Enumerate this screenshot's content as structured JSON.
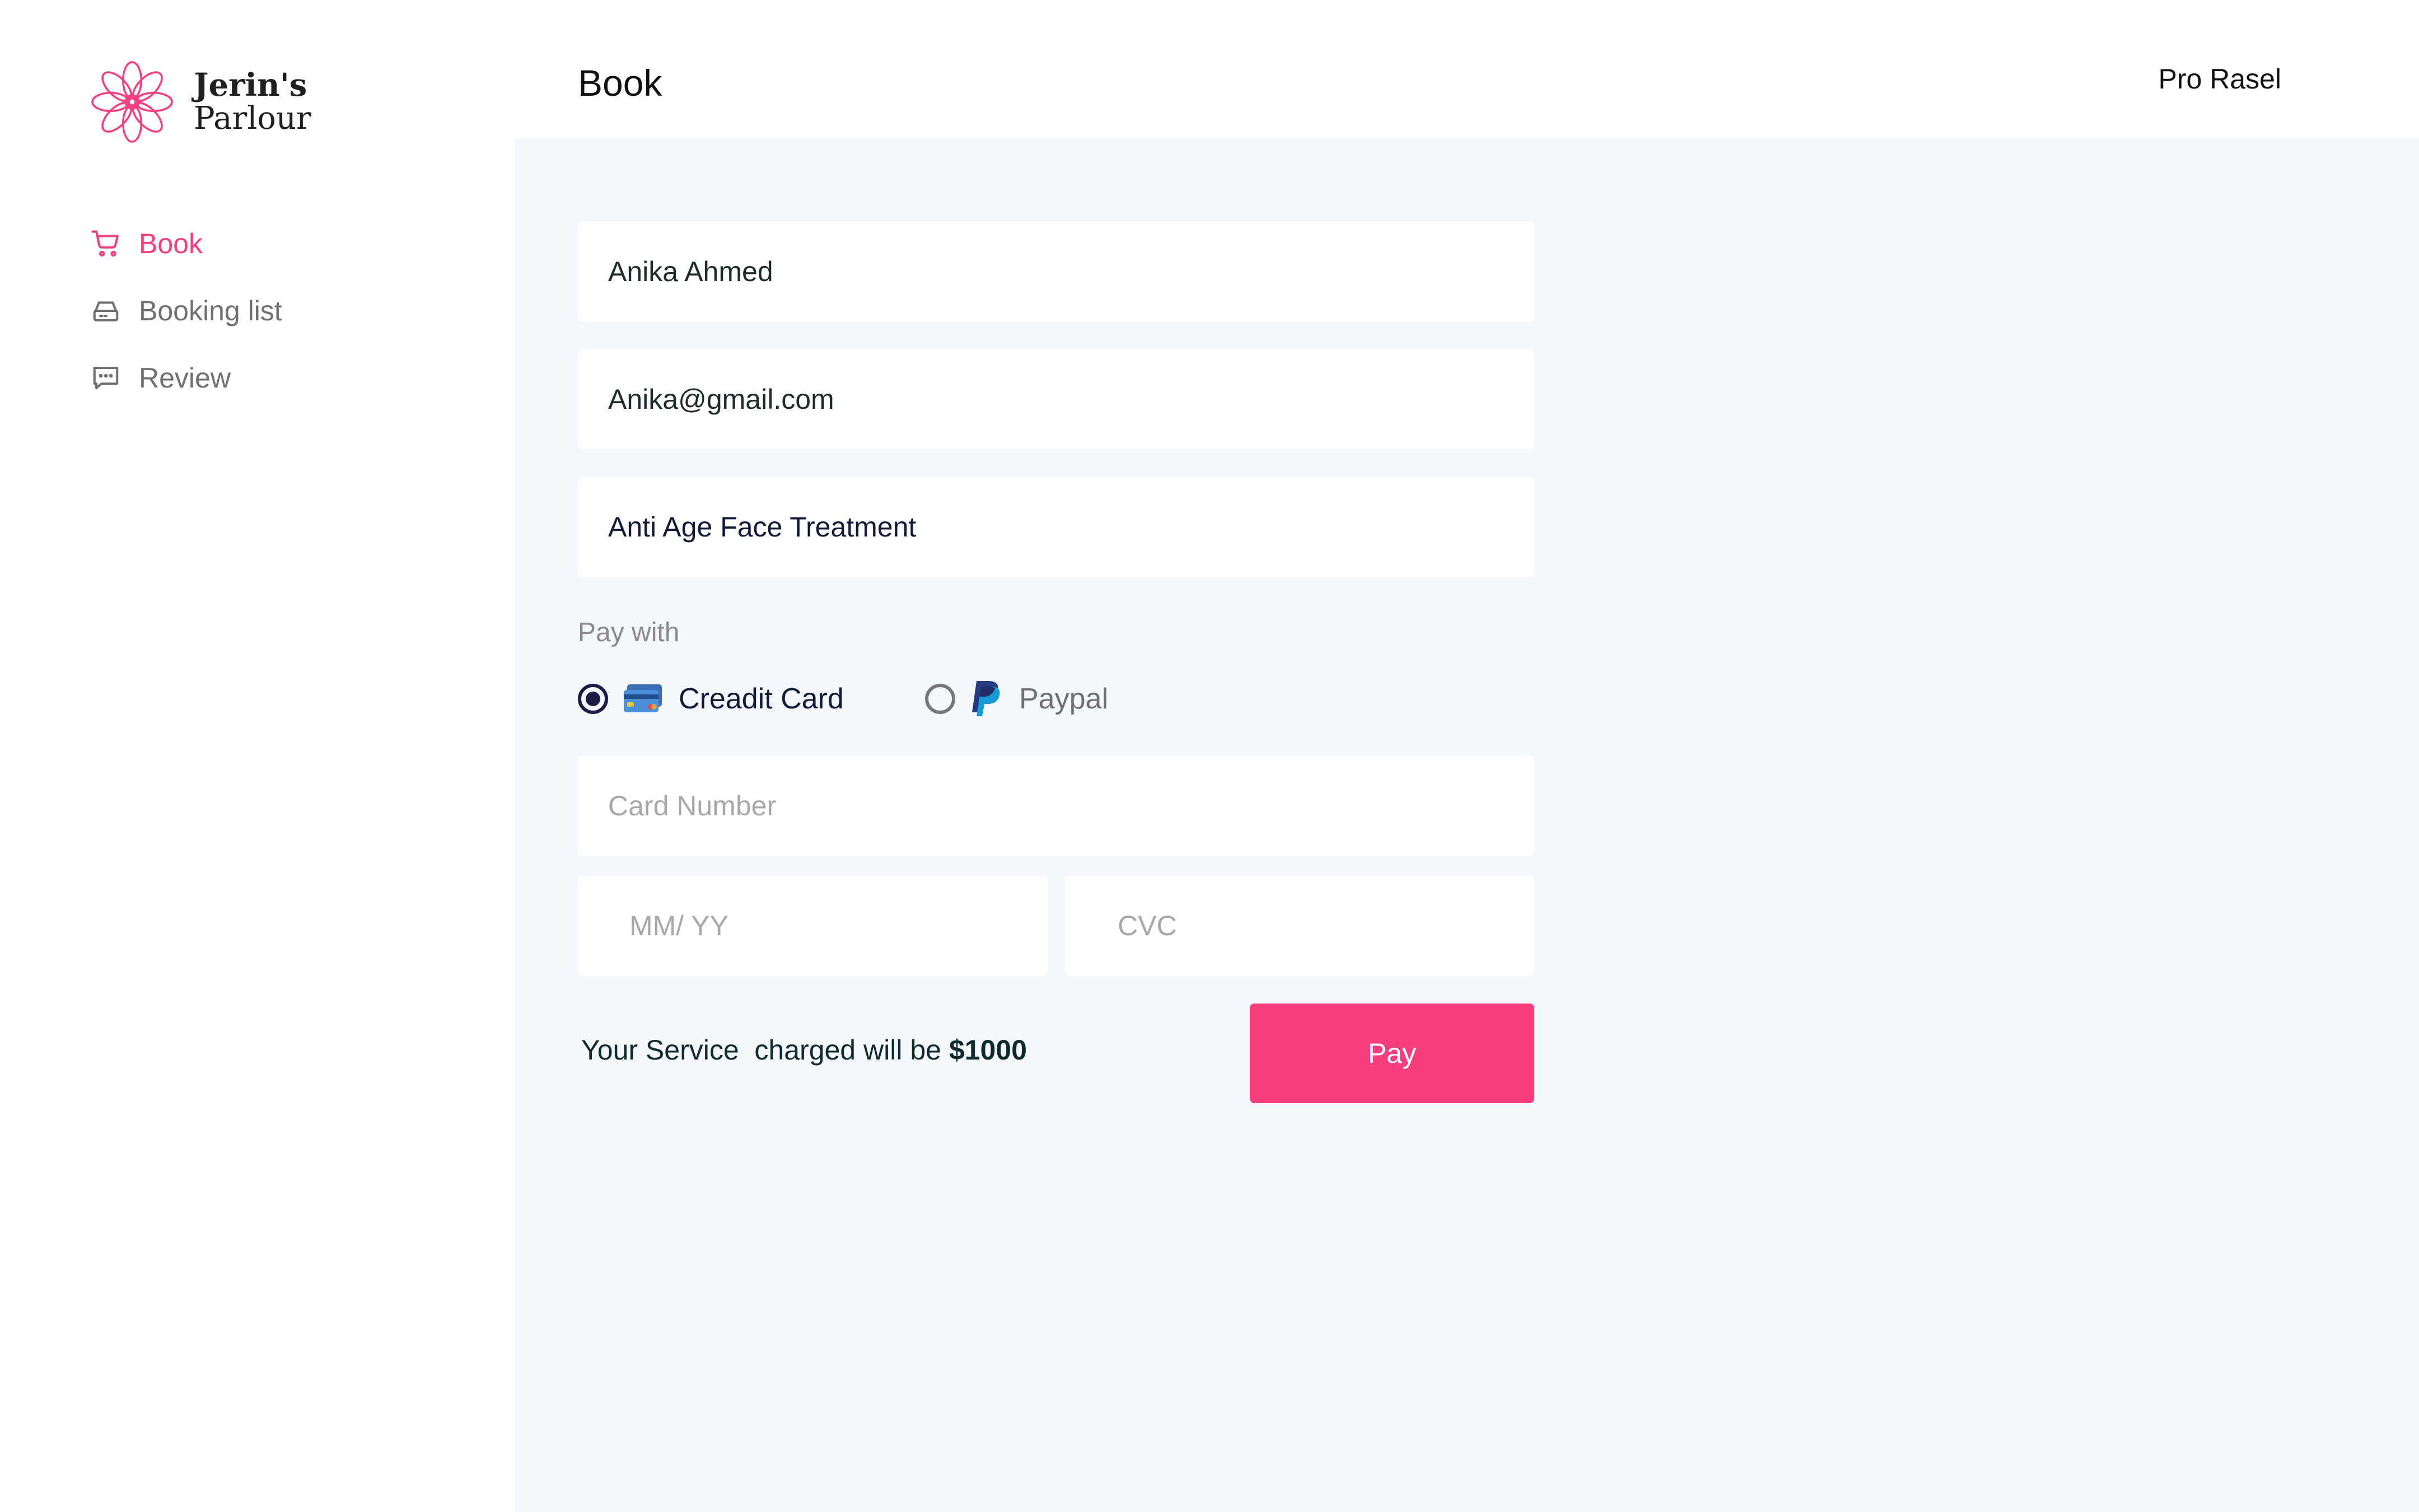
{
  "brand": {
    "name_line1": "Jerin's",
    "name_line2": "Parlour",
    "accent_color": "#F63E7B",
    "logo_icon": "lotus-flower-icon"
  },
  "sidebar": {
    "items": [
      {
        "label": "Book",
        "icon": "cart-icon",
        "active": true
      },
      {
        "label": "Booking list",
        "icon": "inbox-tray-icon",
        "active": false
      },
      {
        "label": "Review",
        "icon": "chat-bubble-icon",
        "active": false
      }
    ]
  },
  "header": {
    "title": "Book",
    "user_name": "Pro Rasel"
  },
  "form": {
    "name_value": "Anika Ahmed",
    "email_value": "Anika@gmail.com",
    "service_value": "Anti Age Face Treatment",
    "pay_with_label": "Pay with",
    "payment_methods": [
      {
        "label": "Creadit Card",
        "icon": "credit-card-icon",
        "selected": true
      },
      {
        "label": "Paypal",
        "icon": "paypal-icon",
        "selected": false
      }
    ],
    "card_number_placeholder": "Card Number",
    "expiry_placeholder": "MM/ YY",
    "cvc_placeholder": "CVC",
    "charge_text": "Your Service  charged will be ",
    "charge_amount": "$1000",
    "pay_button_label": "Pay"
  },
  "colors": {
    "accent": "#F63E7B",
    "main_background": "#F4F7FC",
    "radio_selected": "#1b1b45"
  }
}
